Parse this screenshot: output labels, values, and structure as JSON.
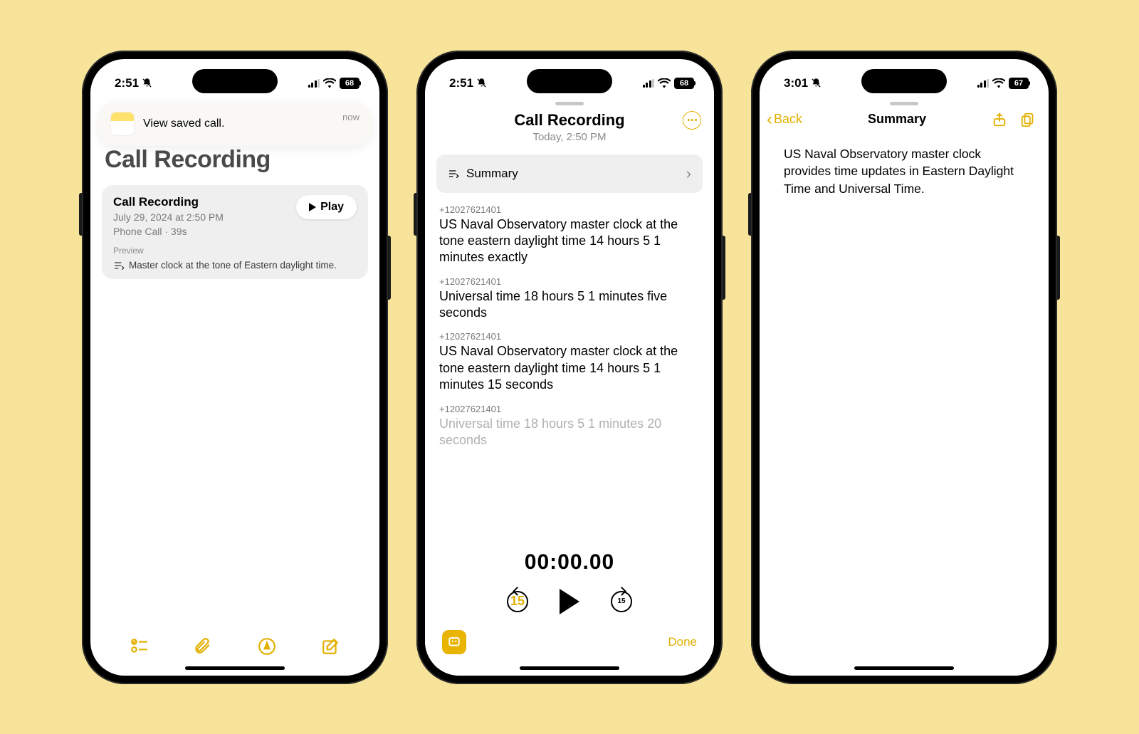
{
  "status": {
    "time1": "2:51",
    "time2": "2:51",
    "time3": "3:01",
    "battery12": "68",
    "battery3": "67"
  },
  "notification": {
    "title": "View saved call.",
    "time": "now"
  },
  "phone1": {
    "heading": "Call Recording",
    "card": {
      "title": "Call Recording",
      "date": "July 29, 2024 at 2:50 PM",
      "meta": "Phone Call · 39s",
      "play": "Play",
      "preview_label": "Preview",
      "preview_text": "Master clock at the tone of Eastern daylight time."
    }
  },
  "phone2": {
    "title": "Call Recording",
    "subtitle": "Today, 2:50 PM",
    "summary_label": "Summary",
    "number": "+12027621401",
    "segments": [
      "US Naval Observatory master clock at the tone eastern daylight time 14 hours 5 1 minutes exactly",
      "Universal time 18 hours 5 1 minutes five seconds",
      "US Naval Observatory master clock at the tone eastern daylight time 14 hours 5 1 minutes 15 seconds",
      "Universal time 18 hours 5 1 minutes 20 seconds"
    ],
    "timecode": "00:00.00",
    "skip": "15",
    "done": "Done"
  },
  "phone3": {
    "back": "Back",
    "title": "Summary",
    "body": "US Naval Observatory master clock provides time updates in Eastern Daylight Time and Universal Time."
  }
}
